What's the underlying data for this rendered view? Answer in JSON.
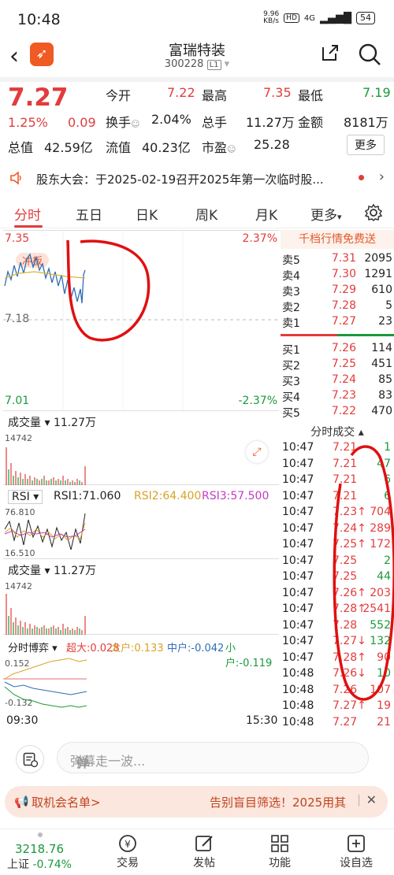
{
  "status": {
    "time": "10:48",
    "speed": "9.96\nKB/s",
    "network": "4G",
    "battery": "54"
  },
  "header": {
    "name": "富瑞特装",
    "code": "300228",
    "level": "L1"
  },
  "quote": {
    "price": "7.27",
    "pct": "1.25%",
    "change": "0.09",
    "open_label": "今开",
    "open": "7.22",
    "high_label": "最高",
    "high": "7.35",
    "low_label": "最低",
    "low": "7.19",
    "turnover_label": "换手",
    "turnover": "2.04%",
    "volume_label": "总手",
    "volume": "11.27万",
    "amount_label": "金额",
    "amount": "8181万",
    "mktcap_label": "总值",
    "mktcap": "42.59亿",
    "float_label": "流值",
    "float": "40.23亿",
    "pe_label": "市盈",
    "pe": "25.28",
    "more": "更多"
  },
  "notice": {
    "text": "股东大会：于2025-02-19召开2025年第一次临时股..."
  },
  "tabs": [
    "分时",
    "五日",
    "日K",
    "周K",
    "月K",
    "更多"
  ],
  "chart": {
    "high": "7.35",
    "high_pct": "2.37%",
    "mid": "7.18",
    "low": "7.01",
    "low_pct": "-2.37%",
    "tag": "冲板",
    "vol_title": "成交量",
    "vol_value": "11.27万",
    "vol_max": "14742",
    "rsi_title": "RSI",
    "rsi1": "RSI1:71.060",
    "rsi2": "RSI2:64.400",
    "rsi3": "RSI3:57.500",
    "rsi_top": "76.810",
    "rsi_bottom": "16.510",
    "vol2_title": "成交量",
    "vol2_value": "11.27万",
    "vol2_max": "14742",
    "game_title": "分时博弈",
    "super": "超大:0.028",
    "big": "大户:0.133",
    "mid_acc": "中户:-0.042",
    "small": "小户:-0.119",
    "game_top": "0.152",
    "game_bottom": "-0.132",
    "t_start": "09:30",
    "t_end": "15:30"
  },
  "orderbook": {
    "head": "千档行情免费送",
    "asks": [
      {
        "k": "卖5",
        "p": "7.31",
        "v": "2095"
      },
      {
        "k": "卖4",
        "p": "7.30",
        "v": "1291"
      },
      {
        "k": "卖3",
        "p": "7.29",
        "v": "610"
      },
      {
        "k": "卖2",
        "p": "7.28",
        "v": "5"
      },
      {
        "k": "卖1",
        "p": "7.27",
        "v": "23"
      }
    ],
    "bids": [
      {
        "k": "买1",
        "p": "7.26",
        "v": "114"
      },
      {
        "k": "买2",
        "p": "7.25",
        "v": "451"
      },
      {
        "k": "买3",
        "p": "7.24",
        "v": "85"
      },
      {
        "k": "买4",
        "p": "7.23",
        "v": "83"
      },
      {
        "k": "买5",
        "p": "7.22",
        "v": "470"
      }
    ],
    "trades_head": "分时成交",
    "trades": [
      {
        "t": "10:47",
        "p": "7.21",
        "v": "1",
        "c": "green"
      },
      {
        "t": "10:47",
        "p": "7.21",
        "v": "47",
        "c": "green"
      },
      {
        "t": "10:47",
        "p": "7.21",
        "v": "6",
        "c": "green"
      },
      {
        "t": "10:47",
        "p": "7.21",
        "v": "6",
        "c": "green"
      },
      {
        "t": "10:47",
        "p": "7.23↑",
        "v": "704",
        "c": "red"
      },
      {
        "t": "10:47",
        "p": "7.24↑",
        "v": "289",
        "c": "red"
      },
      {
        "t": "10:47",
        "p": "7.25↑",
        "v": "172",
        "c": "red"
      },
      {
        "t": "10:47",
        "p": "7.25",
        "v": "2",
        "c": "green"
      },
      {
        "t": "10:47",
        "p": "7.25",
        "v": "44",
        "c": "green"
      },
      {
        "t": "10:47",
        "p": "7.26↑",
        "v": "203",
        "c": "red"
      },
      {
        "t": "10:47",
        "p": "7.28↑",
        "v": "2541",
        "c": "red"
      },
      {
        "t": "10:47",
        "p": "7.28",
        "v": "552",
        "c": "green"
      },
      {
        "t": "10:47",
        "p": "7.27↓",
        "v": "132",
        "c": "green"
      },
      {
        "t": "10:47",
        "p": "7.28↑",
        "v": "90",
        "c": "red"
      },
      {
        "t": "10:48",
        "p": "7.26↓",
        "v": "10",
        "c": "green"
      },
      {
        "t": "10:48",
        "p": "7.26",
        "v": "107",
        "c": "red"
      },
      {
        "t": "10:48",
        "p": "7.27↑",
        "v": "19",
        "c": "red"
      },
      {
        "t": "10:48",
        "p": "7.27",
        "v": "21",
        "c": "red"
      }
    ]
  },
  "comment": {
    "placeholder": "弹幕走一波...",
    "danmu": "弹"
  },
  "promo": {
    "left": "取机会名单>",
    "right": "告别盲目筛选！2025用其"
  },
  "nav": {
    "index_value": "3218.76",
    "index_name": "上证",
    "index_pct": "-0.74%",
    "trade": "交易",
    "post": "发帖",
    "func": "功能",
    "alert": "设自选"
  },
  "colors": {
    "up": "#e23c3c",
    "down": "#1a9a3a",
    "accent": "#f05a23"
  }
}
